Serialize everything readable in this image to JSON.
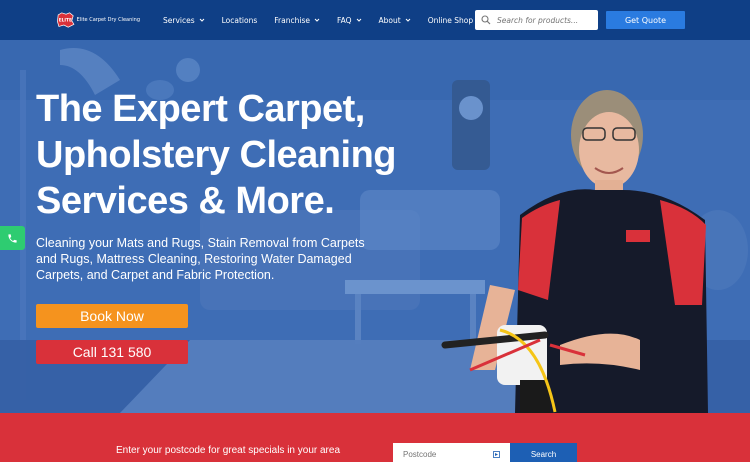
{
  "header": {
    "logo_badge": "ELITE",
    "logo_name": "Elite Carpet Dry Cleaning",
    "nav": [
      {
        "label": "Services",
        "dropdown": true
      },
      {
        "label": "Locations",
        "dropdown": false
      },
      {
        "label": "Franchise",
        "dropdown": true
      },
      {
        "label": "FAQ",
        "dropdown": true
      },
      {
        "label": "About",
        "dropdown": true
      },
      {
        "label": "Online Shop",
        "dropdown": true
      }
    ],
    "search_placeholder": "Search for products...",
    "quote_label": "Get Quote"
  },
  "hero": {
    "title": "The Expert Carpet, Upholstery Cleaning Services & More.",
    "subtitle": "Cleaning your Mats and Rugs, Stain Removal from Carpets and Rugs, Mattress Cleaning, Restoring Water Damaged Carpets, and Carpet and Fabric Protection.",
    "book_label": "Book Now",
    "call_label": "Call 131 580"
  },
  "postcode": {
    "prompt": "Enter your postcode for great specials in your area",
    "placeholder": "Postcode",
    "search_label": "Search"
  },
  "colors": {
    "header_bg": "#0f3f86",
    "accent_blue": "#2a7be0",
    "orange": "#f5931e",
    "red": "#d9313a",
    "green": "#2ecc71"
  }
}
